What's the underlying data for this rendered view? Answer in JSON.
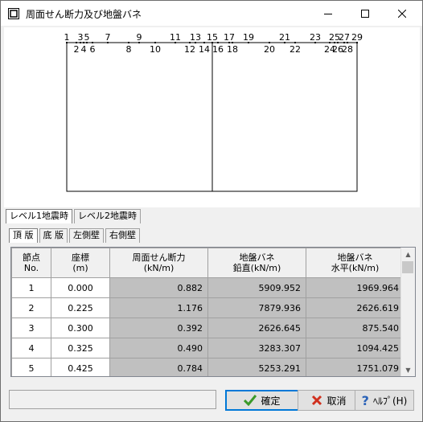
{
  "window": {
    "title": "周面せん断力及び地盤バネ"
  },
  "diagram": {
    "node_labels_top": [
      "1",
      "3",
      "5",
      "7",
      "9",
      "11",
      "13",
      "15",
      "17",
      "19",
      "21",
      "23",
      "25",
      "27",
      "29"
    ],
    "node_labels_bottom": [
      "2",
      "4",
      "6",
      "8",
      "10",
      "12",
      "14",
      "16",
      "18",
      "20",
      "22",
      "24",
      "26",
      "28"
    ],
    "overlap_top": "25",
    "overlap_bottom": "2426",
    "overlap_bottom2": "28"
  },
  "level_tabs": [
    {
      "label": "レベル1地震時",
      "active": true
    },
    {
      "label": "レベル2地震時",
      "active": false
    }
  ],
  "part_tabs": [
    {
      "label": "頂 版",
      "active": true
    },
    {
      "label": "底 版",
      "active": false
    },
    {
      "label": "左側壁",
      "active": false
    },
    {
      "label": "右側壁",
      "active": false
    }
  ],
  "table": {
    "headers": [
      [
        "節点",
        "No."
      ],
      [
        "座標",
        "(m)"
      ],
      [
        "周面せん断力",
        "(kN/m)"
      ],
      [
        "地盤バネ",
        "鉛直(kN/m)"
      ],
      [
        "地盤バネ",
        "水平(kN/m)"
      ]
    ],
    "rows": [
      [
        "1",
        "0.000",
        "0.882",
        "5909.952",
        "1969.964"
      ],
      [
        "2",
        "0.225",
        "1.176",
        "7879.936",
        "2626.619"
      ],
      [
        "3",
        "0.300",
        "0.392",
        "2626.645",
        "875.540"
      ],
      [
        "4",
        "0.325",
        "0.490",
        "3283.307",
        "1094.425"
      ],
      [
        "5",
        "0.425",
        "0.784",
        "5253.291",
        "1751.079"
      ]
    ]
  },
  "buttons": {
    "ok": "確定",
    "cancel": "取消",
    "help": "ﾍﾙﾌﾟ(H)"
  },
  "colors": {
    "ok_icon": "#3a9a2a",
    "cancel_icon": "#d0301e",
    "help_icon": "#2a62b8",
    "focus_border": "#0078d7"
  }
}
